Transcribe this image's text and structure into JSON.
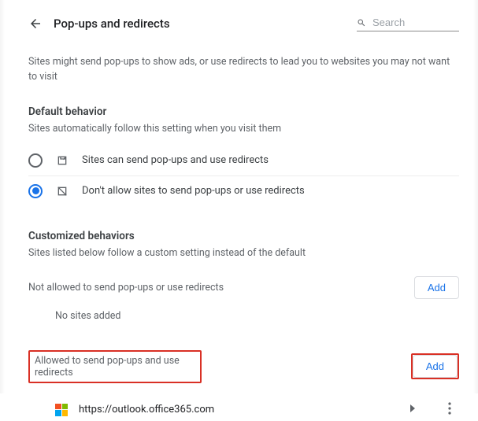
{
  "header": {
    "title": "Pop-ups and redirects",
    "search_placeholder": "Search"
  },
  "intro": "Sites might send pop-ups to show ads, or use redirects to lead you to websites you may not want to visit",
  "default_behavior": {
    "title": "Default behavior",
    "subtitle": "Sites automatically follow this setting when you visit them",
    "options": [
      {
        "label": "Sites can send pop-ups and use redirects",
        "selected": false
      },
      {
        "label": "Don't allow sites to send pop-ups or use redirects",
        "selected": true
      }
    ]
  },
  "customized": {
    "title": "Customized behaviors",
    "subtitle": "Sites listed below follow a custom setting instead of the default",
    "not_allowed": {
      "label": "Not allowed to send pop-ups or use redirects",
      "add_label": "Add",
      "empty": "No sites added"
    },
    "allowed": {
      "label": "Allowed to send pop-ups and use redirects",
      "add_label": "Add",
      "sites": [
        {
          "url": "https://outlook.office365.com",
          "icon": "microsoft"
        }
      ]
    }
  },
  "highlight_color": "#d93025"
}
